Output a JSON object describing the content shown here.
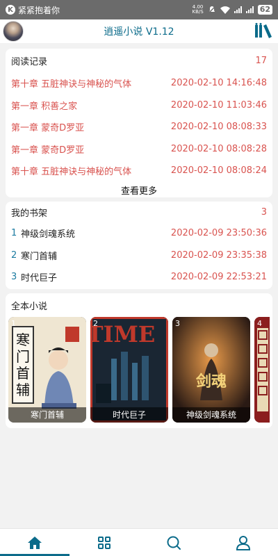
{
  "status_bar": {
    "carrier_icon": "K",
    "notification": "紧紧抱着你",
    "speed_value": "4.00",
    "speed_unit": "KB/S",
    "battery": "62"
  },
  "app": {
    "title": "逍遥小说 V1.12",
    "accent_color": "#0b6b8a",
    "highlight_color": "#d9534f"
  },
  "reading_history": {
    "title": "阅读记录",
    "count": "17",
    "more_label": "查看更多",
    "items": [
      {
        "chapter": "第十章 五脏神诀与神秘的气体",
        "time": "2020-02-10 14:16:48"
      },
      {
        "chapter": "第一章 积善之家",
        "time": "2020-02-10 11:03:46"
      },
      {
        "chapter": "第一章 蒙奇D罗亚",
        "time": "2020-02-10 08:08:33"
      },
      {
        "chapter": "第一章 蒙奇D罗亚",
        "time": "2020-02-10 08:08:28"
      },
      {
        "chapter": "第十章 五脏神诀与神秘的气体",
        "time": "2020-02-10 08:08:24"
      }
    ]
  },
  "bookshelf": {
    "title": "我的书架",
    "count": "3",
    "items": [
      {
        "index": "1",
        "name": "神级剑魂系统",
        "time": "2020-02-09 23:50:36"
      },
      {
        "index": "2",
        "name": "寒门首辅",
        "time": "2020-02-09 23:35:38"
      },
      {
        "index": "3",
        "name": "时代巨子",
        "time": "2020-02-09 22:53:21"
      }
    ]
  },
  "all_novels": {
    "title": "全本小说",
    "items": [
      {
        "index": "1",
        "name": "寒门首辅",
        "cover_text": "寒门首辅"
      },
      {
        "index": "2",
        "name": "时代巨子",
        "cover_text": "TIME"
      },
      {
        "index": "3",
        "name": "神级剑魂系统",
        "cover_text": "神级剑魂系统"
      },
      {
        "index": "4",
        "name": "",
        "cover_text": ""
      }
    ]
  },
  "tabs": [
    {
      "name": "home",
      "icon": "home-icon"
    },
    {
      "name": "category",
      "icon": "grid-icon"
    },
    {
      "name": "search",
      "icon": "search-icon"
    },
    {
      "name": "profile",
      "icon": "user-icon"
    }
  ]
}
